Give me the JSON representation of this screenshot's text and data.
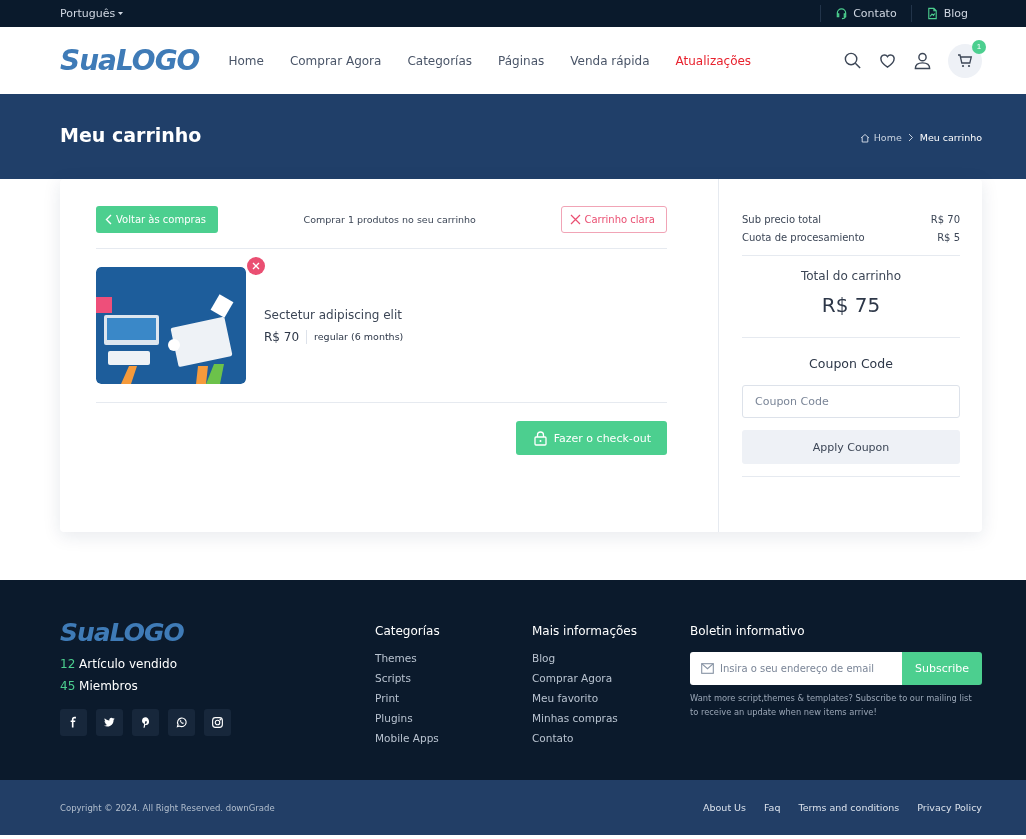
{
  "top_bar": {
    "language": "Português",
    "links": [
      {
        "label": "Contato",
        "kind": "headset"
      },
      {
        "label": "Blog",
        "kind": "document"
      }
    ]
  },
  "header": {
    "logo": "SuaLOGO",
    "nav": [
      {
        "label": "Home",
        "selected": false
      },
      {
        "label": "Comprar Agora",
        "selected": false
      },
      {
        "label": "Categorías",
        "selected": false
      },
      {
        "label": "Páginas",
        "selected": false
      },
      {
        "label": "Venda rápida",
        "selected": false
      },
      {
        "label": "Atualizações",
        "selected": true
      }
    ],
    "cart_count": "1"
  },
  "banner": {
    "title": "Meu carrinho",
    "breadcrumb": [
      "Home",
      "Meu carrinho"
    ]
  },
  "cart": {
    "back_button": "Voltar às compras",
    "summary": "Comprar 1 produtos no seu carrinho",
    "clear_button": "Carrinho clara",
    "items": [
      {
        "name": "Sectetur adipiscing elit",
        "price": "R$ 70",
        "license": "regular (6 months)"
      }
    ],
    "checkout_button": "Fazer o check-out"
  },
  "totals": {
    "rows": [
      {
        "label": "Sub precio total",
        "value": "R$ 70"
      },
      {
        "label": "Cuota de procesamiento",
        "value": "R$ 5"
      }
    ],
    "total_label": "Total do carrinho",
    "total_value": "R$ 75",
    "coupon_title": "Coupon Code",
    "coupon_placeholder": "Coupon Code",
    "apply_button": "Apply Coupon"
  },
  "footer": {
    "logo": "SuaLOGO",
    "stats": [
      {
        "count": "12",
        "label": "Artículo vendido"
      },
      {
        "count": "45",
        "label": "Miembros"
      }
    ],
    "social": [
      {
        "kind": "facebook"
      },
      {
        "kind": "twitter"
      },
      {
        "kind": "pinterest"
      },
      {
        "kind": "whatsapp"
      },
      {
        "kind": "instagram"
      }
    ],
    "columns": [
      {
        "title": "Categorías",
        "links": [
          "Themes",
          "Scripts",
          "Print",
          "Plugins",
          "Mobile Apps"
        ]
      },
      {
        "title": "Mais informações",
        "links": [
          "Blog",
          "Comprar Agora",
          "Meu favorito",
          "Minhas compras",
          "Contato"
        ]
      }
    ],
    "newsletter": {
      "title": "Boletin informativo",
      "placeholder": "Insira o seu endereço de email",
      "button": "Subscribe",
      "note": "Want more script,themes & templates? Subscribe to our mailing list to receive an update when new items arrive!"
    }
  },
  "bottom_bar": {
    "copyright": "Copyright © 2024. All Right Reserved. downGrade",
    "links": [
      "About Us",
      "Faq",
      "Terms and conditions",
      "Privacy Policy"
    ]
  }
}
